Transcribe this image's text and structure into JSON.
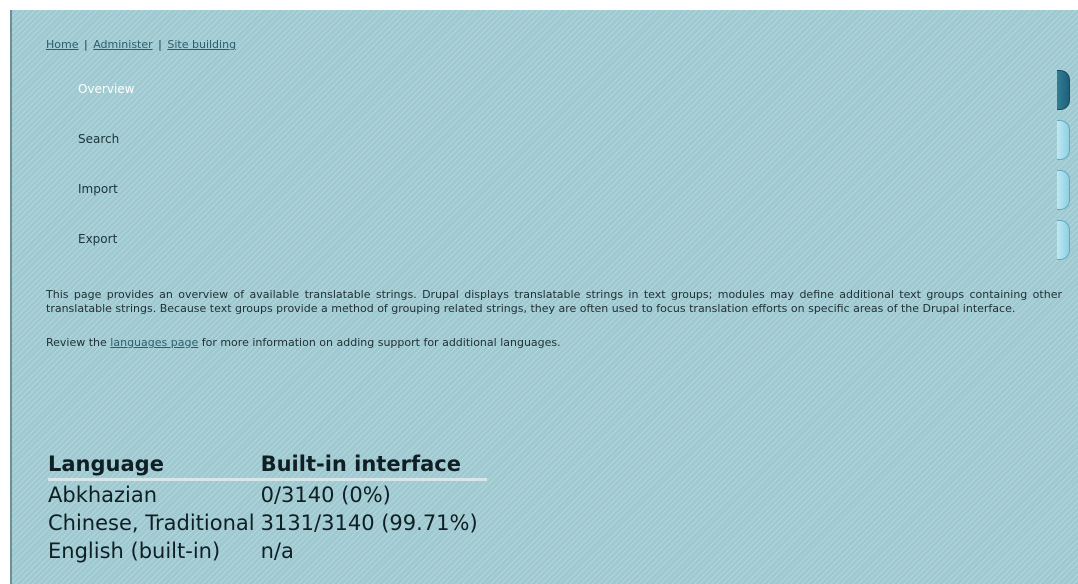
{
  "breadcrumb": {
    "items": [
      "Home",
      "Administer",
      "Site building"
    ],
    "separator": "|"
  },
  "tabs": [
    {
      "label": "Overview",
      "active": true
    },
    {
      "label": "Search",
      "active": false
    },
    {
      "label": "Import",
      "active": false
    },
    {
      "label": "Export",
      "active": false
    }
  ],
  "intro": {
    "paragraph": "This page provides an overview of available translatable strings. Drupal displays translatable strings in text groups; modules may define additional text groups containing other translatable strings. Because text groups provide a method of grouping related strings, they are often used to focus translation efforts on specific areas of the Drupal interface.",
    "review_prefix": "Review the ",
    "review_link": "languages page",
    "review_suffix": " for more information on adding support for additional languages."
  },
  "table": {
    "headers": [
      "Language",
      "Built-in interface"
    ],
    "rows": [
      [
        "Abkhazian",
        "0/3140 (0%)"
      ],
      [
        "Chinese, Traditional",
        "3131/3140 (99.71%)"
      ],
      [
        "English (built-in)",
        "n/a"
      ]
    ]
  },
  "colors": {
    "background": "#9ec9d1",
    "active_tab": "#1f5f78",
    "link": "#2a5f6d"
  }
}
